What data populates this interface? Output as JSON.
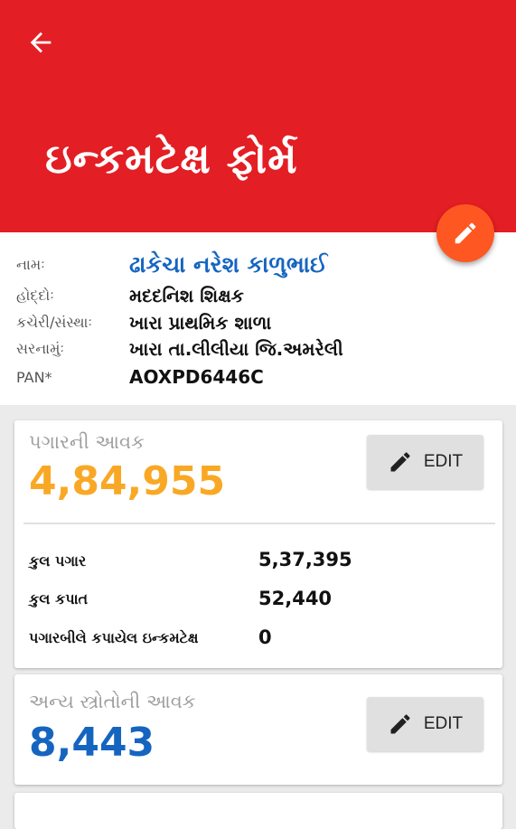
{
  "header": {
    "title": "ઇન્કમટેક્ષ ફોર્મ",
    "color": "#e31e24"
  },
  "icons": {
    "back": "arrow-back-icon",
    "fab": "pencil-icon",
    "edit": "pencil-icon"
  },
  "profile": {
    "rows": [
      {
        "label": "નામઃ",
        "value": "ઢાકેચા નરેશ કાળુભાઈ"
      },
      {
        "label": "હોદ્દોઃ",
        "value": "મદદનિશ શિક્ષક"
      },
      {
        "label": "કચેરી/સંસ્થાઃ",
        "value": "ખારા પ્રાથમિક શાળા"
      },
      {
        "label": "સરનામુંઃ",
        "value": "ખારા તા.લીલીયા જિ.અમરેલી"
      },
      {
        "label": "PAN*",
        "value": "AOXPD6446C"
      }
    ]
  },
  "salary_card": {
    "title": "પગારની આવક",
    "amount": "4,84,955",
    "amount_color": "#f9a825",
    "edit_label": "EDIT",
    "details": [
      {
        "label": "કુલ પગાર",
        "value": "5,37,395"
      },
      {
        "label": "કુલ કપાત",
        "value": "52,440"
      },
      {
        "label": "પગારબીલે કપાયેલ ઇન્કમટેક્ષ",
        "value": "0"
      }
    ]
  },
  "other_card": {
    "title": "અન્ય સ્ત્રોતોની આવક",
    "amount": "8,443",
    "amount_color": "#1565c0",
    "edit_label": "EDIT"
  }
}
